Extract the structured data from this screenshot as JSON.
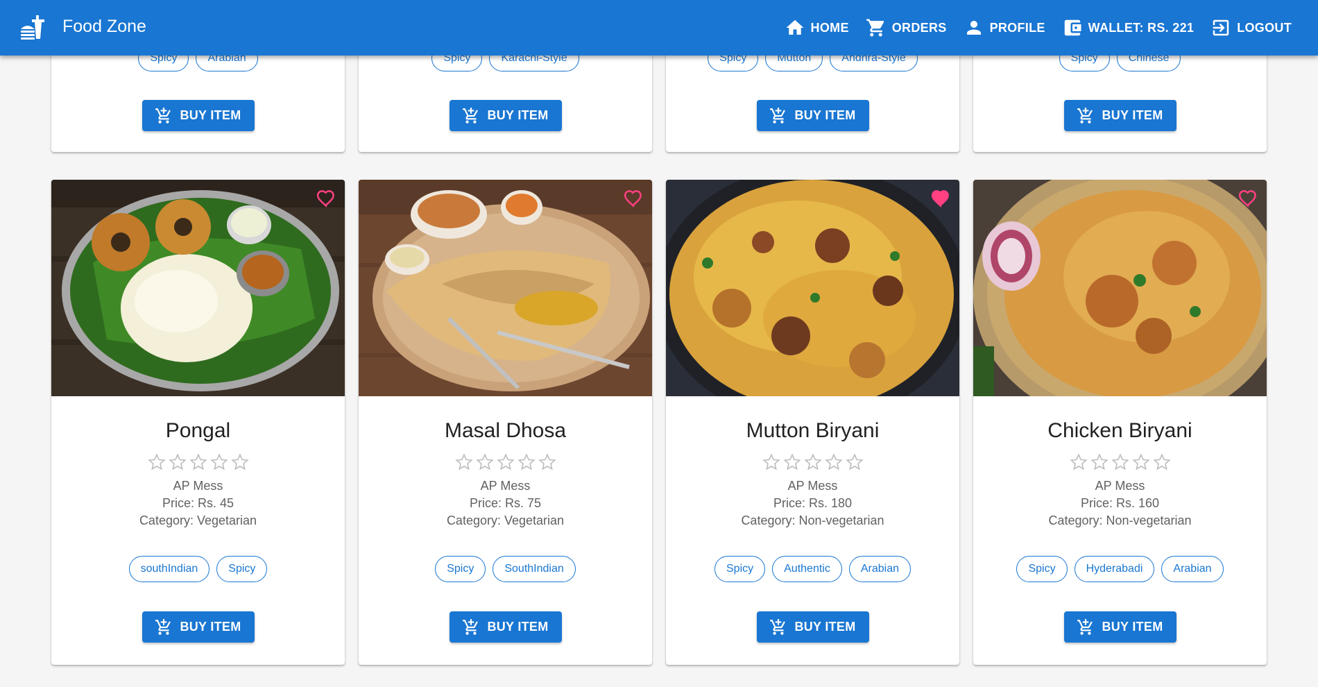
{
  "header": {
    "title": "Food Zone",
    "nav": [
      {
        "label": "HOME",
        "icon": "home-icon"
      },
      {
        "label": "ORDERS",
        "icon": "cart-icon"
      },
      {
        "label": "PROFILE",
        "icon": "person-icon"
      },
      {
        "label": "WALLET: RS. 221",
        "icon": "wallet-icon"
      },
      {
        "label": "LOGOUT",
        "icon": "logout-icon"
      }
    ]
  },
  "colors": {
    "primary": "#1976d2",
    "heart": "#ff4081"
  },
  "top_cards": [
    {
      "tags": [
        "Spicy",
        "Arabian"
      ],
      "buy_label": "BUY ITEM"
    },
    {
      "tags": [
        "Spicy",
        "Karachi-Style"
      ],
      "buy_label": "BUY ITEM"
    },
    {
      "tags": [
        "Spicy",
        "Mutton",
        "Andhra-Style"
      ],
      "buy_label": "BUY ITEM"
    },
    {
      "tags": [
        "Spicy",
        "Chinese"
      ],
      "buy_label": "BUY ITEM"
    }
  ],
  "cards": [
    {
      "name": "Pongal",
      "mess": "AP Mess",
      "price": "Price: Rs. 45",
      "category": "Category: Vegetarian",
      "tags": [
        "southIndian",
        "Spicy"
      ],
      "favorite": false,
      "rating": 0,
      "buy_label": "BUY ITEM"
    },
    {
      "name": "Masal Dhosa",
      "mess": "AP Mess",
      "price": "Price: Rs. 75",
      "category": "Category: Vegetarian",
      "tags": [
        "Spicy",
        "SouthIndian"
      ],
      "favorite": false,
      "rating": 0,
      "buy_label": "BUY ITEM"
    },
    {
      "name": "Mutton Biryani",
      "mess": "AP Mess",
      "price": "Price: Rs. 180",
      "category": "Category: Non-vegetarian",
      "tags": [
        "Spicy",
        "Authentic",
        "Arabian"
      ],
      "favorite": true,
      "rating": 0,
      "buy_label": "BUY ITEM"
    },
    {
      "name": "Chicken Biryani",
      "mess": "AP Mess",
      "price": "Price: Rs. 160",
      "category": "Category: Non-vegetarian",
      "tags": [
        "Spicy",
        "Hyderabadi",
        "Arabian"
      ],
      "favorite": false,
      "rating": 0,
      "buy_label": "BUY ITEM"
    }
  ]
}
